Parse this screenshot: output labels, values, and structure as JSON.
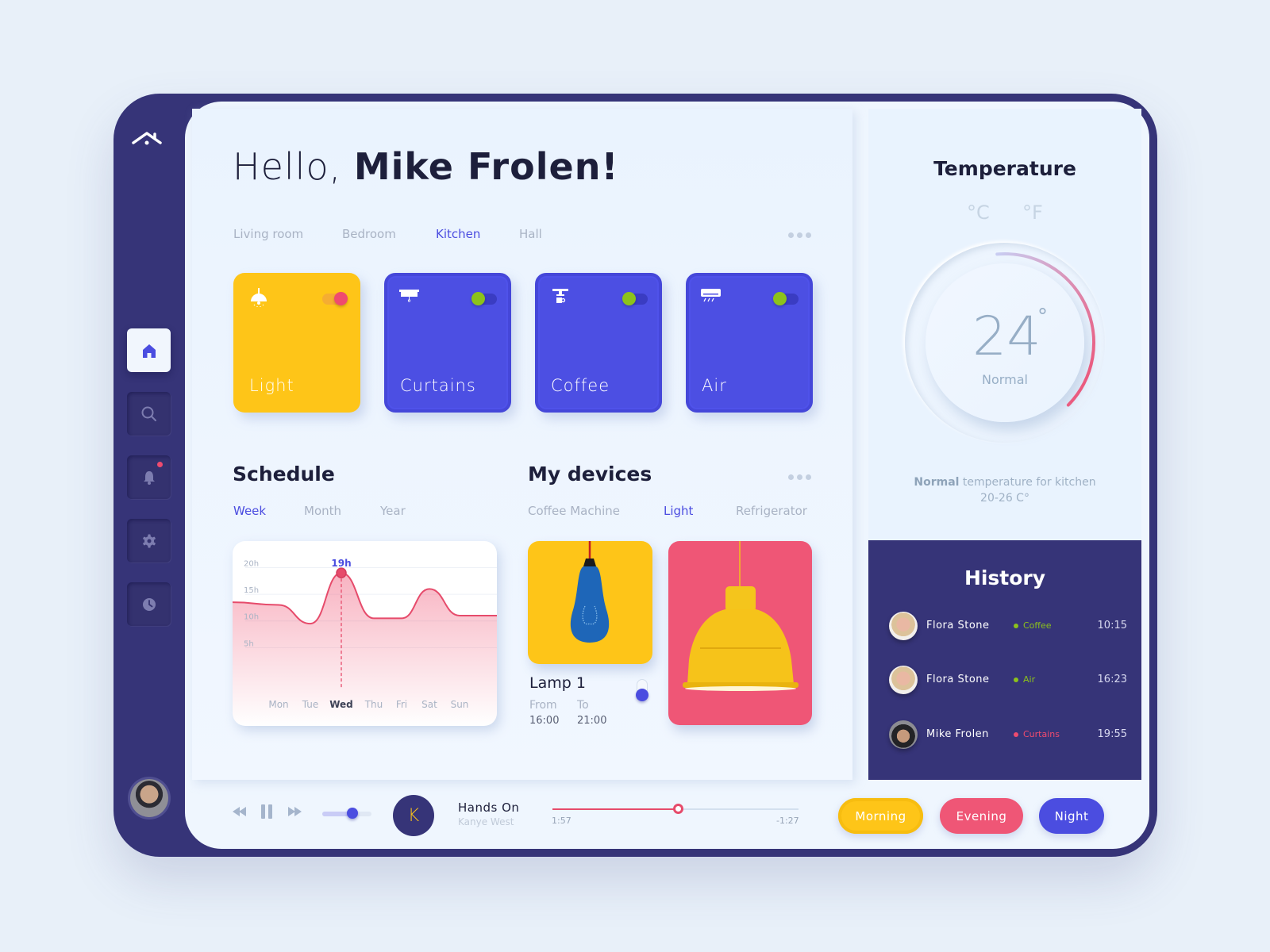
{
  "colors": {
    "navy": "#363478",
    "accent_blue": "#4b4de0",
    "yellow": "#fec518",
    "pink": "#ef5676",
    "green": "#8cc21b",
    "text_dark": "#1d1f3b",
    "text_muted": "#a9b3c4"
  },
  "sidebar": {
    "logo_icon": "home-roof-icon",
    "items": [
      {
        "name": "home",
        "icon": "home-icon",
        "active": true
      },
      {
        "name": "search",
        "icon": "search-icon",
        "active": false
      },
      {
        "name": "notifications",
        "icon": "bell-icon",
        "active": false,
        "badge": true
      },
      {
        "name": "settings",
        "icon": "gear-icon",
        "active": false
      },
      {
        "name": "history",
        "icon": "clock-icon",
        "active": false
      }
    ],
    "avatar": "Mike Frolen"
  },
  "greeting": {
    "prefix": "Hello,",
    "name": "Mike Frolen!"
  },
  "rooms": {
    "tabs": [
      "Living room",
      "Bedroom",
      "Kitchen",
      "Hall"
    ],
    "active": "Kitchen",
    "more_icon": "more-dots-icon"
  },
  "devices": [
    {
      "label": "Light",
      "icon": "ceiling-lamp-icon",
      "color": "yellow",
      "toggle": "on-pink"
    },
    {
      "label": "Curtains",
      "icon": "curtains-icon",
      "color": "blue",
      "toggle": "green"
    },
    {
      "label": "Coffee",
      "icon": "coffee-machine-icon",
      "color": "blue",
      "toggle": "green"
    },
    {
      "label": "Air",
      "icon": "air-conditioner-icon",
      "color": "blue",
      "toggle": "green"
    }
  ],
  "schedule": {
    "title": "Schedule",
    "tabs": [
      "Week",
      "Month",
      "Year"
    ],
    "active": "Week"
  },
  "chart_data": {
    "type": "area",
    "title": "Schedule",
    "categories": [
      "Mon",
      "Tue",
      "Wed",
      "Thu",
      "Fri",
      "Sat",
      "Sun"
    ],
    "highlight_category": "Wed",
    "highlight_label": "19h",
    "series": [
      {
        "name": "Hours",
        "values": [
          13,
          9.5,
          19,
          10.5,
          10.5,
          16,
          11
        ]
      }
    ],
    "ytick_labels": [
      "20h",
      "15h",
      "10h",
      "5h"
    ],
    "yticks": [
      20,
      15,
      10,
      5
    ],
    "ylim": [
      0,
      22
    ],
    "grid": true,
    "xlabel": "",
    "ylabel": ""
  },
  "my_devices": {
    "title": "My devices",
    "tabs": [
      "Coffee Machine",
      "Light",
      "Refrigerator"
    ],
    "active": "Light",
    "lamp": {
      "name": "Lamp 1",
      "from_label": "From",
      "to_label": "To",
      "from": "16:00",
      "to": "21:00"
    }
  },
  "temperature": {
    "title": "Temperature",
    "unit_c": "°C",
    "unit_f": "°F",
    "value": "24",
    "degree": "°",
    "status": "Normal",
    "note_bold": "Normal",
    "note_rest": " temperature for kitchen",
    "range": "20-26 C°",
    "gauge_fraction": 0.3
  },
  "history": {
    "title": "History",
    "entries": [
      {
        "name": "Flora Stone",
        "device": "Coffee",
        "status_color": "#8cc21b",
        "time": "10:15",
        "avatar": "flora"
      },
      {
        "name": "Flora Stone",
        "device": "Air",
        "status_color": "#8cc21b",
        "time": "16:23",
        "avatar": "flora"
      },
      {
        "name": "Mike Frolen",
        "device": "Curtains",
        "status_color": "#ef4b6f",
        "time": "19:55",
        "avatar": "mike"
      }
    ]
  },
  "player": {
    "song": "Hands On",
    "artist": "Kanye West",
    "album_letter": "K",
    "elapsed": "1:57",
    "remaining": "-1:27",
    "progress": 0.51,
    "volume": 0.62
  },
  "modes": [
    "Morning",
    "Evening",
    "Night"
  ]
}
